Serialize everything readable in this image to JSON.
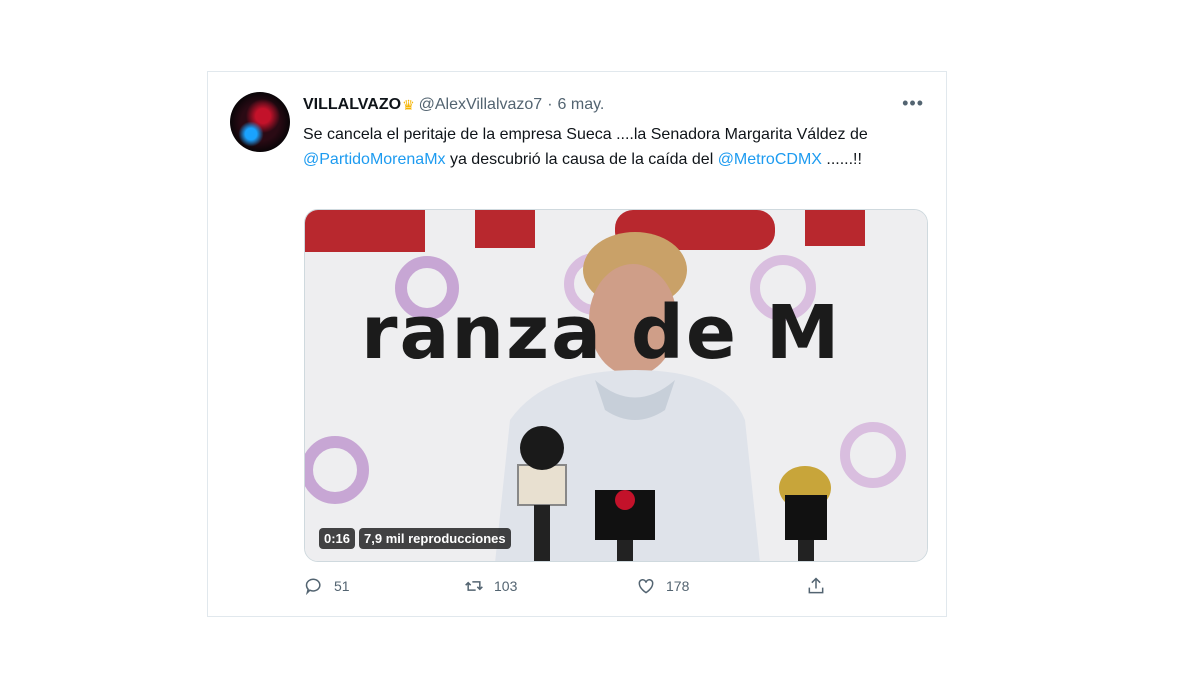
{
  "tweet": {
    "display_name": "VILLALVAZO",
    "handle": "@AlexVillalvazo7",
    "date": "6 may.",
    "separator": "·",
    "text_1": "Se cancela el peritaje de la empresa Sueca ....la Senadora Margarita Váldez de ",
    "mention_1": "@PartidoMorenaMx",
    "text_2": " ya descubrió la causa de la caída del ",
    "mention_2": "@MetroCDMX",
    "text_3": " ......!!",
    "more_label": "•••"
  },
  "media": {
    "banner_text": "ranza de M",
    "duration": "0:16",
    "views": "7,9 mil reproducciones"
  },
  "actions": {
    "replies": "51",
    "retweets": "103",
    "likes": "178"
  },
  "colors": {
    "accent": "#1d9bf0",
    "brand_red": "#b8282e",
    "ring_purple": "#c7a6d4",
    "crown": "#f5b400"
  },
  "icons": [
    "crown-icon",
    "more-icon",
    "reply-icon",
    "retweet-icon",
    "like-icon",
    "share-icon"
  ]
}
